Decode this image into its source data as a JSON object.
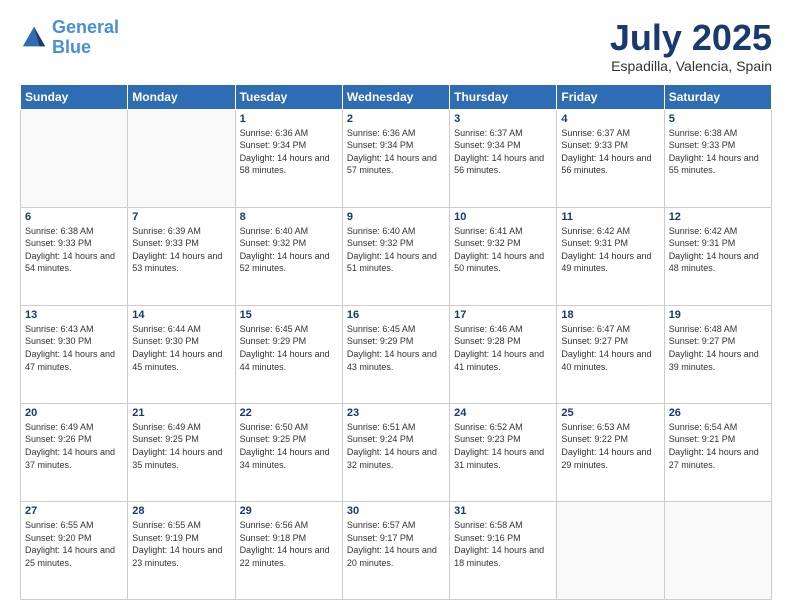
{
  "header": {
    "logo_line1": "General",
    "logo_line2": "Blue",
    "month_title": "July 2025",
    "subtitle": "Espadilla, Valencia, Spain"
  },
  "days_of_week": [
    "Sunday",
    "Monday",
    "Tuesday",
    "Wednesday",
    "Thursday",
    "Friday",
    "Saturday"
  ],
  "weeks": [
    [
      {
        "day": "",
        "info": ""
      },
      {
        "day": "",
        "info": ""
      },
      {
        "day": "1",
        "info": "Sunrise: 6:36 AM\nSunset: 9:34 PM\nDaylight: 14 hours and 58 minutes."
      },
      {
        "day": "2",
        "info": "Sunrise: 6:36 AM\nSunset: 9:34 PM\nDaylight: 14 hours and 57 minutes."
      },
      {
        "day": "3",
        "info": "Sunrise: 6:37 AM\nSunset: 9:34 PM\nDaylight: 14 hours and 56 minutes."
      },
      {
        "day": "4",
        "info": "Sunrise: 6:37 AM\nSunset: 9:33 PM\nDaylight: 14 hours and 56 minutes."
      },
      {
        "day": "5",
        "info": "Sunrise: 6:38 AM\nSunset: 9:33 PM\nDaylight: 14 hours and 55 minutes."
      }
    ],
    [
      {
        "day": "6",
        "info": "Sunrise: 6:38 AM\nSunset: 9:33 PM\nDaylight: 14 hours and 54 minutes."
      },
      {
        "day": "7",
        "info": "Sunrise: 6:39 AM\nSunset: 9:33 PM\nDaylight: 14 hours and 53 minutes."
      },
      {
        "day": "8",
        "info": "Sunrise: 6:40 AM\nSunset: 9:32 PM\nDaylight: 14 hours and 52 minutes."
      },
      {
        "day": "9",
        "info": "Sunrise: 6:40 AM\nSunset: 9:32 PM\nDaylight: 14 hours and 51 minutes."
      },
      {
        "day": "10",
        "info": "Sunrise: 6:41 AM\nSunset: 9:32 PM\nDaylight: 14 hours and 50 minutes."
      },
      {
        "day": "11",
        "info": "Sunrise: 6:42 AM\nSunset: 9:31 PM\nDaylight: 14 hours and 49 minutes."
      },
      {
        "day": "12",
        "info": "Sunrise: 6:42 AM\nSunset: 9:31 PM\nDaylight: 14 hours and 48 minutes."
      }
    ],
    [
      {
        "day": "13",
        "info": "Sunrise: 6:43 AM\nSunset: 9:30 PM\nDaylight: 14 hours and 47 minutes."
      },
      {
        "day": "14",
        "info": "Sunrise: 6:44 AM\nSunset: 9:30 PM\nDaylight: 14 hours and 45 minutes."
      },
      {
        "day": "15",
        "info": "Sunrise: 6:45 AM\nSunset: 9:29 PM\nDaylight: 14 hours and 44 minutes."
      },
      {
        "day": "16",
        "info": "Sunrise: 6:45 AM\nSunset: 9:29 PM\nDaylight: 14 hours and 43 minutes."
      },
      {
        "day": "17",
        "info": "Sunrise: 6:46 AM\nSunset: 9:28 PM\nDaylight: 14 hours and 41 minutes."
      },
      {
        "day": "18",
        "info": "Sunrise: 6:47 AM\nSunset: 9:27 PM\nDaylight: 14 hours and 40 minutes."
      },
      {
        "day": "19",
        "info": "Sunrise: 6:48 AM\nSunset: 9:27 PM\nDaylight: 14 hours and 39 minutes."
      }
    ],
    [
      {
        "day": "20",
        "info": "Sunrise: 6:49 AM\nSunset: 9:26 PM\nDaylight: 14 hours and 37 minutes."
      },
      {
        "day": "21",
        "info": "Sunrise: 6:49 AM\nSunset: 9:25 PM\nDaylight: 14 hours and 35 minutes."
      },
      {
        "day": "22",
        "info": "Sunrise: 6:50 AM\nSunset: 9:25 PM\nDaylight: 14 hours and 34 minutes."
      },
      {
        "day": "23",
        "info": "Sunrise: 6:51 AM\nSunset: 9:24 PM\nDaylight: 14 hours and 32 minutes."
      },
      {
        "day": "24",
        "info": "Sunrise: 6:52 AM\nSunset: 9:23 PM\nDaylight: 14 hours and 31 minutes."
      },
      {
        "day": "25",
        "info": "Sunrise: 6:53 AM\nSunset: 9:22 PM\nDaylight: 14 hours and 29 minutes."
      },
      {
        "day": "26",
        "info": "Sunrise: 6:54 AM\nSunset: 9:21 PM\nDaylight: 14 hours and 27 minutes."
      }
    ],
    [
      {
        "day": "27",
        "info": "Sunrise: 6:55 AM\nSunset: 9:20 PM\nDaylight: 14 hours and 25 minutes."
      },
      {
        "day": "28",
        "info": "Sunrise: 6:55 AM\nSunset: 9:19 PM\nDaylight: 14 hours and 23 minutes."
      },
      {
        "day": "29",
        "info": "Sunrise: 6:56 AM\nSunset: 9:18 PM\nDaylight: 14 hours and 22 minutes."
      },
      {
        "day": "30",
        "info": "Sunrise: 6:57 AM\nSunset: 9:17 PM\nDaylight: 14 hours and 20 minutes."
      },
      {
        "day": "31",
        "info": "Sunrise: 6:58 AM\nSunset: 9:16 PM\nDaylight: 14 hours and 18 minutes."
      },
      {
        "day": "",
        "info": ""
      },
      {
        "day": "",
        "info": ""
      }
    ]
  ]
}
